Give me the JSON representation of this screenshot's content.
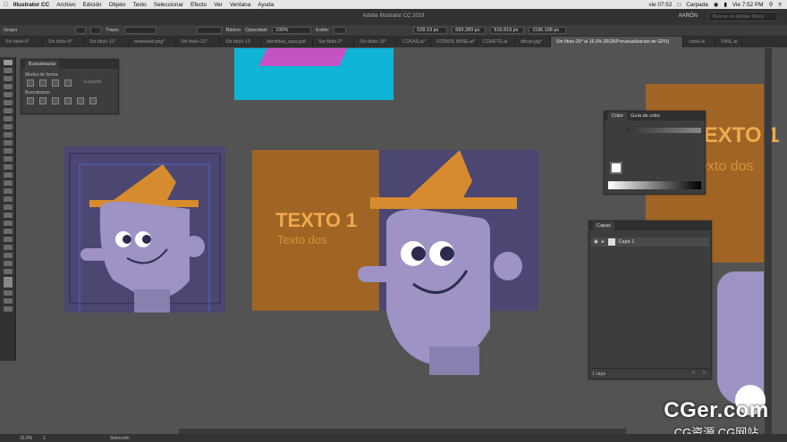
{
  "menubar": {
    "app_name": "Illustrator CC",
    "items": [
      "Archivo",
      "Edición",
      "Objeto",
      "Texto",
      "Seleccionar",
      "Efecto",
      "Ver",
      "Ventana",
      "Ayuda"
    ],
    "clock_day": "vie 07:52",
    "carrier": "Carpada",
    "clock_right": "Vie 7:52 PM"
  },
  "window": {
    "title": "Adobe Illustrator CC 2019",
    "user": "AARÓN",
    "search_placeholder": "Buscar en Adobe Stock"
  },
  "controlbar": {
    "group_label": "Grupo",
    "stroke_label": "Trazo:",
    "brush_label": "Básico",
    "opacity_label": "Opacidad:",
    "opacity_value": "100%",
    "style_label": "Estilo:",
    "x_value": "528.19 px",
    "y_value": "683.289 px",
    "w_value": "916.819 px",
    "h_value": "1195.198 px"
  },
  "tabs": [
    {
      "label": "Sin título-8*"
    },
    {
      "label": "Sin título-8*"
    },
    {
      "label": "Sin título-11*"
    },
    {
      "label": "download.png*"
    },
    {
      "label": "Sin título-12*"
    },
    {
      "label": "Sin título-13"
    },
    {
      "label": "identidad_casa.pdf"
    },
    {
      "label": "Sin título-2*"
    },
    {
      "label": "Sin título-18*"
    },
    {
      "label": "COSAS.ai*"
    },
    {
      "label": "ICONOS BASE.ai*"
    },
    {
      "label": "COHETE.ai"
    },
    {
      "label": "dibujo.jpg*"
    },
    {
      "label": "Sin título-20* al 16.9% (RGB/Previsualización de GPU)"
    },
    {
      "label": "cartel.ai"
    },
    {
      "label": "VINIL.ai"
    }
  ],
  "pathfinder": {
    "title": "Buscatrazos",
    "shape_modes": "Modos de forma:",
    "expand": "Expandir",
    "pathfinders": "Buscatrazos:"
  },
  "color_panel": {
    "tab_color": "Color",
    "tab_guide": "Guía de color"
  },
  "layers_panel": {
    "title": "Capas",
    "layer_name": "Capa 1",
    "count": "1 capa"
  },
  "artboard": {
    "main_text": "TEXTO 1",
    "sub_text": "Texto dos",
    "right_main_text": "TEXTO 1",
    "right_sub_text": "Texto dos"
  },
  "statusbar": {
    "zoom": "16.9%",
    "page": "1",
    "mode": "Selección"
  },
  "watermark": {
    "big": "CGer.com",
    "small": "CG资源 CG网站"
  },
  "colors": {
    "purple_bg": "#4c4672",
    "orange": "#a06525",
    "hat": "#d68c2e",
    "face": "#9e93c4",
    "cyan": "#0fb5d6",
    "magenta": "#c454c4"
  }
}
